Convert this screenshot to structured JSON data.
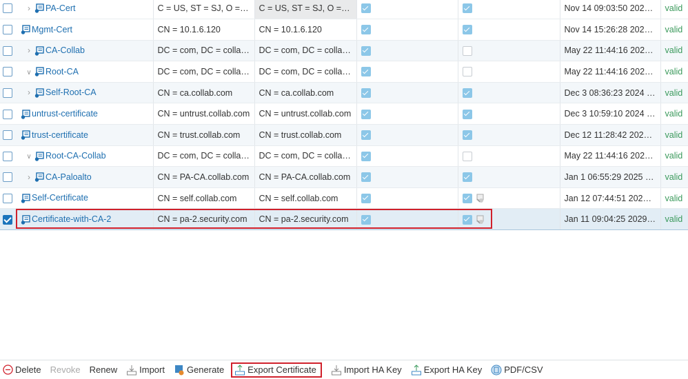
{
  "rows": [
    {
      "name": "PA-Cert",
      "expander": "collapsed",
      "subject": "C = US, ST = SJ, O = Sec...",
      "issuer": "C = US, ST = SJ, O = Security, CN = pa.collab.com",
      "ca": true,
      "key": true,
      "expires": "Nov 14 09:03:50 2024 ...",
      "status": "valid"
    },
    {
      "name": "Mgmt-Cert",
      "expander": "none",
      "subject": "CN = 10.1.6.120",
      "issuer": "CN = 10.1.6.120",
      "ca": true,
      "key": true,
      "expires": "Nov 14 15:26:28 2024 ...",
      "status": "valid"
    },
    {
      "name": "CA-Collab",
      "expander": "collapsed",
      "subject": "DC = com, DC = collab, ...",
      "issuer": "DC = com, DC = collab, ...",
      "ca": true,
      "key": false,
      "expires": "May 22 11:44:16 2027 ...",
      "status": "valid"
    },
    {
      "name": "Root-CA",
      "expander": "expanded",
      "subject": "DC = com, DC = collab, ...",
      "issuer": "DC = com, DC = collab, ...",
      "ca": true,
      "key": false,
      "expires": "May 22 11:44:16 2027 ...",
      "status": "valid"
    },
    {
      "name": "Self-Root-CA",
      "expander": "collapsed",
      "subject": "CN = ca.collab.com",
      "issuer": "CN = ca.collab.com",
      "ca": true,
      "key": true,
      "expires": "Dec 3 08:36:23 2024 G...",
      "status": "valid"
    },
    {
      "name": "untrust-certificate",
      "expander": "none",
      "subject": "CN = untrust.collab.com",
      "issuer": "CN = untrust.collab.com",
      "ca": true,
      "key": true,
      "expires": "Dec 3 10:59:10 2024 G...",
      "status": "valid"
    },
    {
      "name": "trust-certificate",
      "expander": "none",
      "subject": "CN = trust.collab.com",
      "issuer": "CN = trust.collab.com",
      "ca": true,
      "key": true,
      "expires": "Dec 12 11:28:42 2024 ...",
      "status": "valid"
    },
    {
      "name": "Root-CA-Collab",
      "expander": "expanded",
      "subject": "DC = com, DC = collab, ...",
      "issuer": "DC = com, DC = collab, ...",
      "ca": true,
      "key": false,
      "expires": "May 22 11:44:16 2027 ...",
      "status": "valid"
    },
    {
      "name": "CA-Paloalto",
      "expander": "collapsed",
      "subject": "CN = PA-CA.collab.com",
      "issuer": "CN = PA-CA.collab.com",
      "ca": true,
      "key": true,
      "expires": "Jan 1 06:55:29 2025 GMT",
      "status": "valid"
    },
    {
      "name": "Self-Certificate",
      "expander": "none",
      "subject": "CN = self.collab.com",
      "issuer": "CN = self.collab.com",
      "ca": true,
      "key": true,
      "ha": true,
      "expires": "Jan 12 07:44:51 2025 G...",
      "status": "valid"
    },
    {
      "name": "Certificate-with-CA-2",
      "expander": "none",
      "subject": "CN = pa-2.security.com",
      "issuer": "CN = pa-2.security.com",
      "ca": true,
      "key": true,
      "ha": true,
      "expires": "Jan 11 09:04:25 2029 G...",
      "status": "valid",
      "selected": true
    }
  ],
  "toolbar": {
    "delete": "Delete",
    "revoke": "Revoke",
    "renew": "Renew",
    "import": "Import",
    "generate": "Generate",
    "export_certificate": "Export Certificate",
    "import_ha_key": "Import HA Key",
    "export_ha_key": "Export HA Key",
    "pdf_csv": "PDF/CSV"
  },
  "colors": {
    "link": "#1e6fb0",
    "valid": "#3b9a5c",
    "highlight": "#d0202b"
  }
}
